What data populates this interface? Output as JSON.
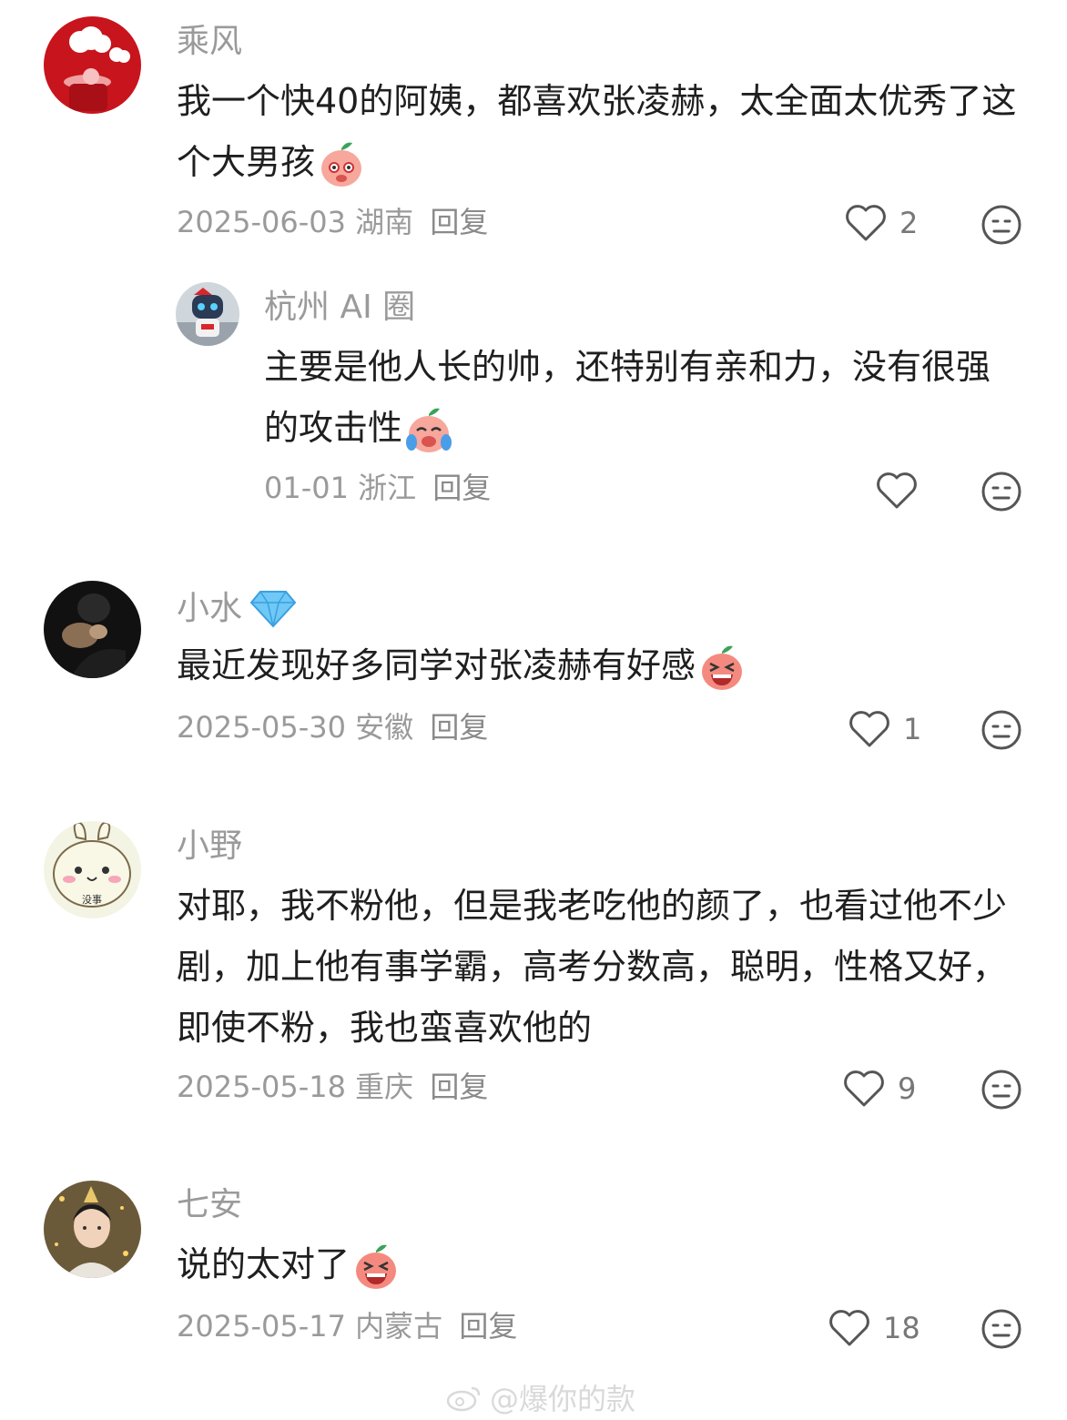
{
  "comments": [
    {
      "username": "乘风",
      "text": "我一个快40的阿姨，都喜欢张凌赫，太全面太优秀了这个大男孩",
      "date": "2025-06-03",
      "location": "湖南",
      "reply": "回复",
      "likes": "2",
      "avatar_icon": "red-mug-clouds-avatar",
      "emoji": "blushing-peach-emoji"
    },
    {
      "username": "杭州 AI 圈",
      "text": "主要是他人长的帅，还特别有亲和力，没有很强的攻击性",
      "date": "01-01",
      "location": "浙江",
      "reply": "回复",
      "likes": "",
      "avatar_icon": "robot-avatar",
      "emoji": "laugh-cry-peach-emoji"
    },
    {
      "username": "小水",
      "text": "最近发现好多同学对张凌赫有好感",
      "date": "2025-05-30",
      "location": "安徽",
      "reply": "回复",
      "likes": "1",
      "avatar_icon": "dark-photo-avatar",
      "badge_icon": "diamond-icon",
      "emoji": "laughing-peach-emoji"
    },
    {
      "username": "小野",
      "text": "对耶，我不粉他，但是我老吃他的颜了，也看过他不少剧，加上他有事学霸，高考分数高，聪明，性格又好，即使不粉，我也蛮喜欢他的",
      "date": "2025-05-18",
      "location": "重庆",
      "reply": "回复",
      "likes": "9",
      "avatar_icon": "rabbit-cartoon-avatar",
      "avatar_text": "没事"
    },
    {
      "username": "七安",
      "text": "说的太对了",
      "date": "2025-05-17",
      "location": "内蒙古",
      "reply": "回复",
      "likes": "18",
      "avatar_icon": "portrait-avatar",
      "emoji": "laughing-peach-emoji"
    }
  ],
  "watermark": "@爆你的款",
  "colors": {
    "meta": "#9a9a9a",
    "text": "#1f1f1f",
    "icon": "#555555"
  }
}
